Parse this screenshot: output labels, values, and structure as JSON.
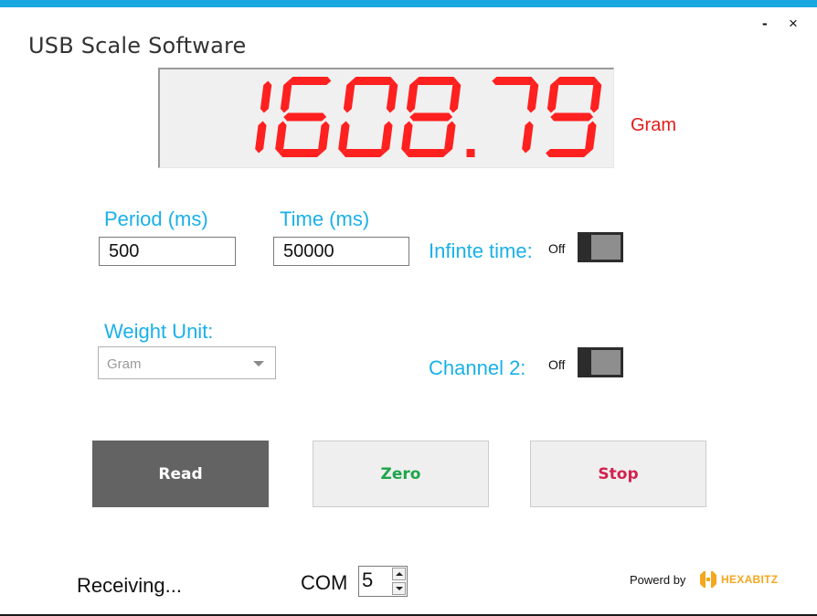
{
  "window": {
    "title": "USB Scale Software",
    "minimize_label": "-",
    "close_label": "×"
  },
  "display": {
    "reading": "1608.79",
    "unit": "Gram",
    "color": "#ff2020"
  },
  "settings": {
    "period_label": "Period (ms)",
    "period_value": "500",
    "time_label": "Time (ms)",
    "time_value": "50000",
    "infinite_label": "Infinte time:",
    "infinite_state": "Off",
    "weight_unit_label": "Weight Unit:",
    "weight_unit_value": "Gram",
    "channel2_label": "Channel 2:",
    "channel2_state": "Off"
  },
  "buttons": {
    "read": "Read",
    "zero": "Zero",
    "stop": "Stop"
  },
  "footer": {
    "status": "Receiving...",
    "com_label": "COM",
    "com_value": "5",
    "powered_by": "Powerd by",
    "brand": "HEXABITZ"
  },
  "colors": {
    "accent": "#1ab0e8",
    "read_button": "#636363",
    "zero_text": "#1ea64a",
    "stop_text": "#d2224f",
    "brand": "#f4a71d"
  },
  "icons": [
    "minimize-icon",
    "close-icon",
    "dropdown-caret-icon",
    "spin-up-icon",
    "spin-down-icon",
    "hexabitz-logo-icon"
  ]
}
